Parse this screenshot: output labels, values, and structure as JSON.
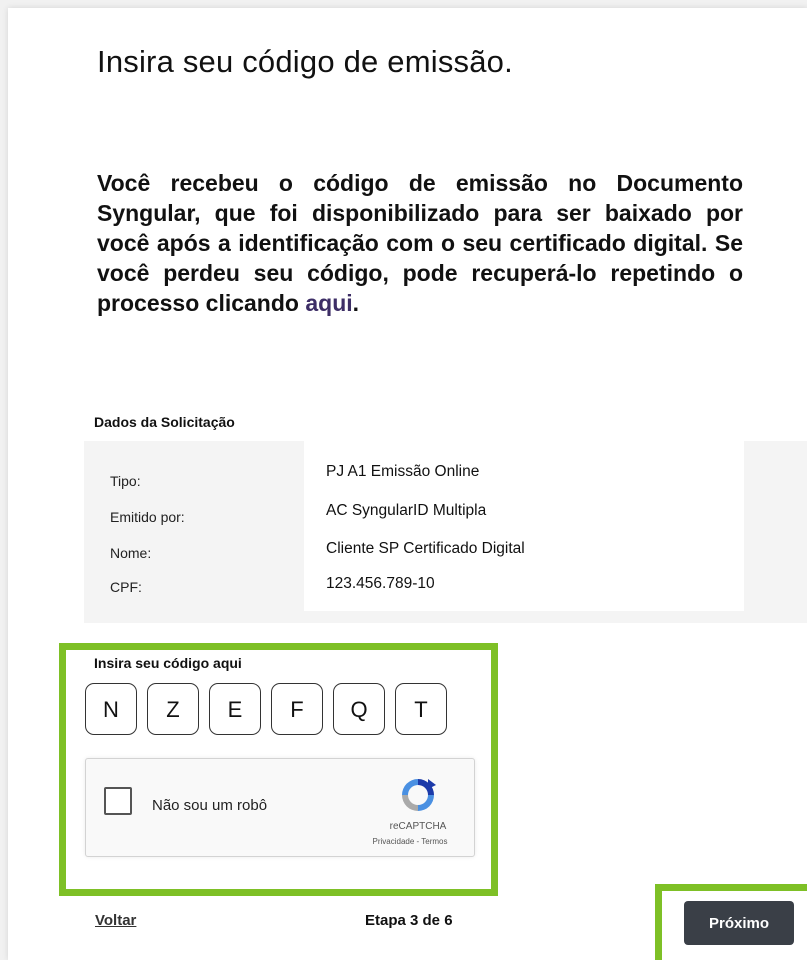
{
  "header": {
    "title": "Insira seu código de emissão."
  },
  "intro": {
    "text_before_link": "Você recebeu o código de emissão no Documento Syngular, que foi disponibilizado para ser baixado por você após a identificação com o seu certificado digital. Se você perdeu seu código, pode recuperá-lo repetindo o processo clicando ",
    "link_text": "aqui",
    "text_after_link": "."
  },
  "request": {
    "section_title": "Dados da Solicitação",
    "rows": [
      {
        "label": "Tipo:",
        "value": "PJ A1 Emissão Online"
      },
      {
        "label": "Emitido por:",
        "value": "AC SyngularID Multipla"
      },
      {
        "label": "Nome:",
        "value": "Cliente SP Certificado Digital"
      },
      {
        "label": "CPF:",
        "value": "123.456.789-10"
      }
    ]
  },
  "code": {
    "label": "Insira seu código aqui",
    "chars": [
      "N",
      "Z",
      "E",
      "F",
      "Q",
      "T"
    ]
  },
  "recaptcha": {
    "checkbox_label": "Não sou um robô",
    "brand": "reCAPTCHA",
    "links": "Privacidade - Termos"
  },
  "footer": {
    "back_label": "Voltar",
    "step_text": "Etapa 3 de 6",
    "next_label": "Próximo"
  },
  "colors": {
    "highlight": "#7ec026",
    "link": "#3d2e66",
    "button": "#3a3f47"
  }
}
